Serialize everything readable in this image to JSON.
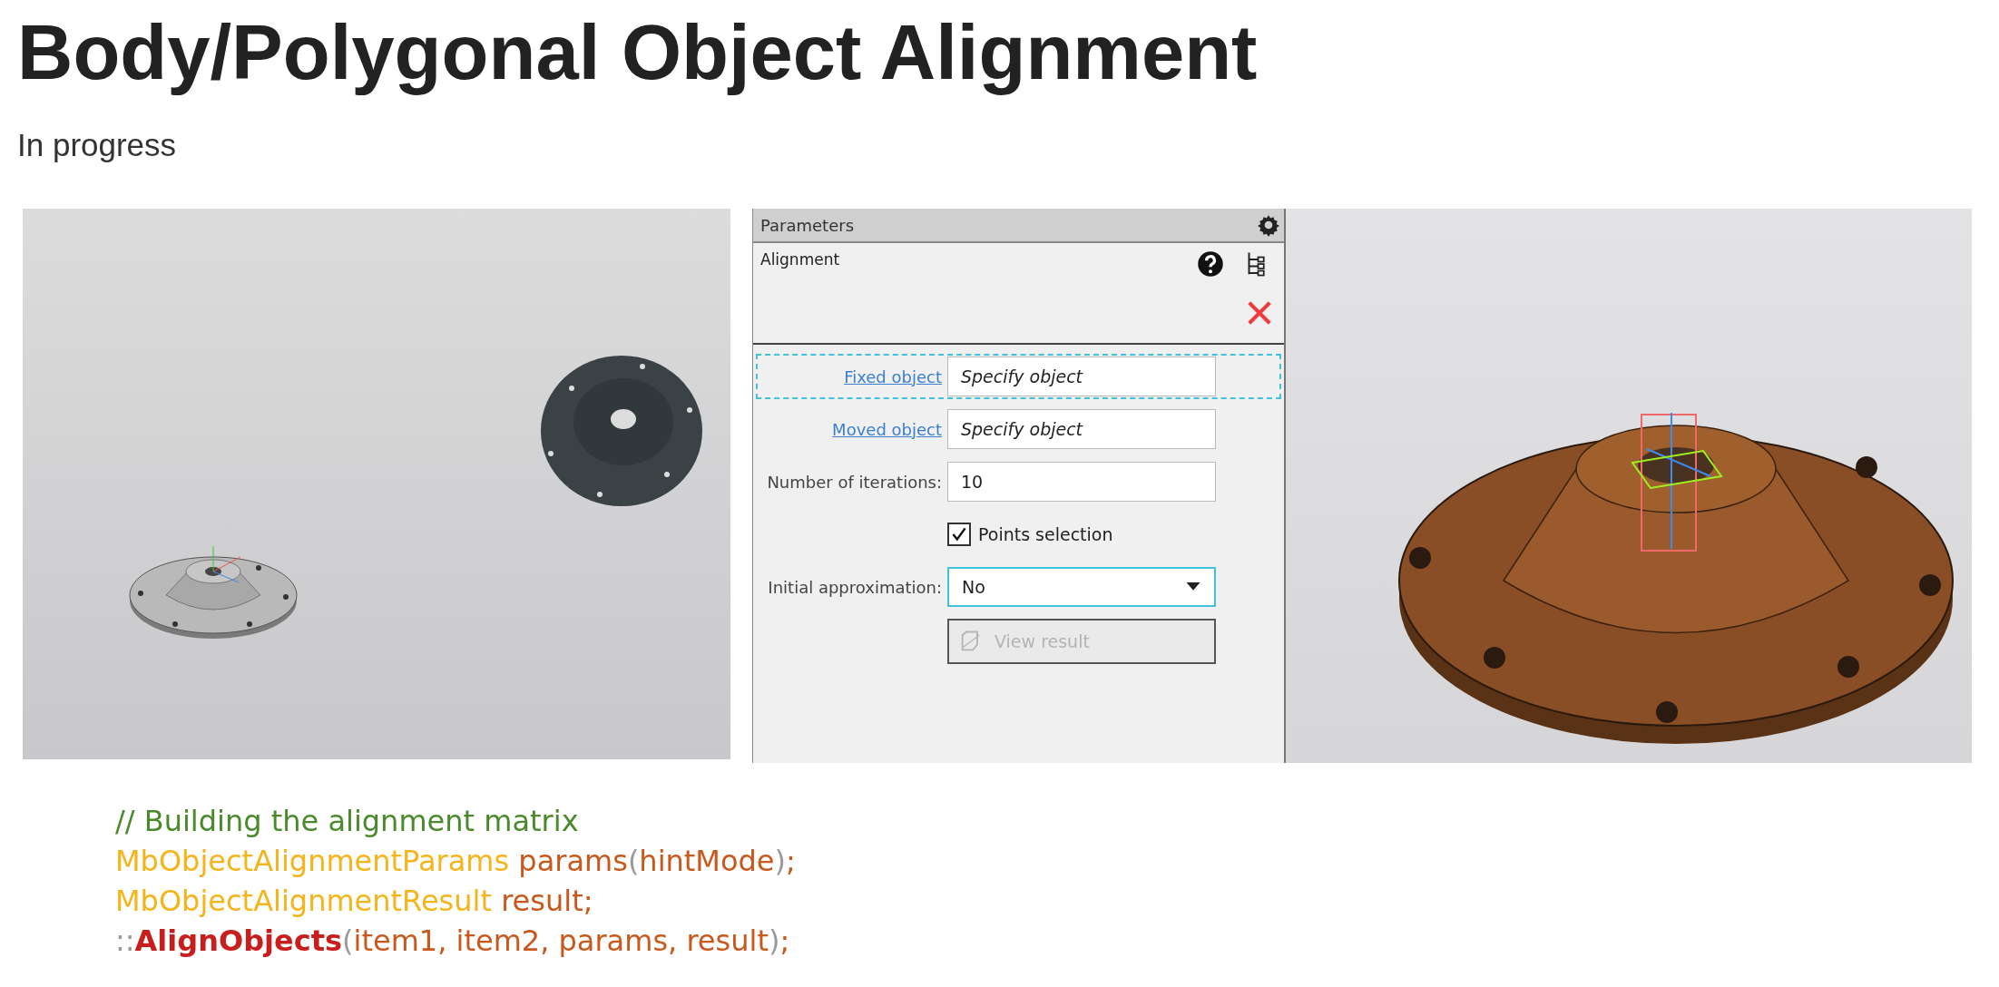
{
  "title": "Body/Polygonal Object Alignment",
  "subtitle": "In progress",
  "panel": {
    "header": "Parameters",
    "section_title": "Alignment",
    "fields": [
      {
        "kind": "link-field",
        "label": "Fixed object",
        "placeholder": "Specify object",
        "focused": true
      },
      {
        "kind": "link-field",
        "label": "Moved object",
        "placeholder": "Specify object",
        "focused": false
      },
      {
        "kind": "text",
        "label": "Number of iterations:",
        "value": "10"
      },
      {
        "kind": "checkbox",
        "label": "Points selection",
        "checked": true
      },
      {
        "kind": "dropdown",
        "label": "Initial approximation:",
        "value": "No"
      },
      {
        "kind": "button",
        "label": "View result",
        "disabled": true
      }
    ]
  },
  "code": [
    [
      {
        "kind": "comment",
        "text": "// Building the alignment matrix"
      }
    ],
    [
      {
        "kind": "type",
        "text": "MbObjectAlignmentParams "
      },
      {
        "kind": "variable",
        "text": "params"
      },
      {
        "kind": "punct",
        "text": "("
      },
      {
        "kind": "variable",
        "text": "hintMode"
      },
      {
        "kind": "punct",
        "text": ")"
      },
      {
        "kind": "variable",
        "text": ";"
      }
    ],
    [
      {
        "kind": "type",
        "text": "MbObjectAlignmentResult "
      },
      {
        "kind": "variable",
        "text": "result;"
      }
    ],
    [
      {
        "kind": "punct",
        "text": "::"
      },
      {
        "kind": "function",
        "text": "AlignObjects"
      },
      {
        "kind": "punct",
        "text": "("
      },
      {
        "kind": "variable",
        "text": "item1, item2, params, result"
      },
      {
        "kind": "punct",
        "text": ")"
      },
      {
        "kind": "variable",
        "text": ";"
      }
    ]
  ]
}
